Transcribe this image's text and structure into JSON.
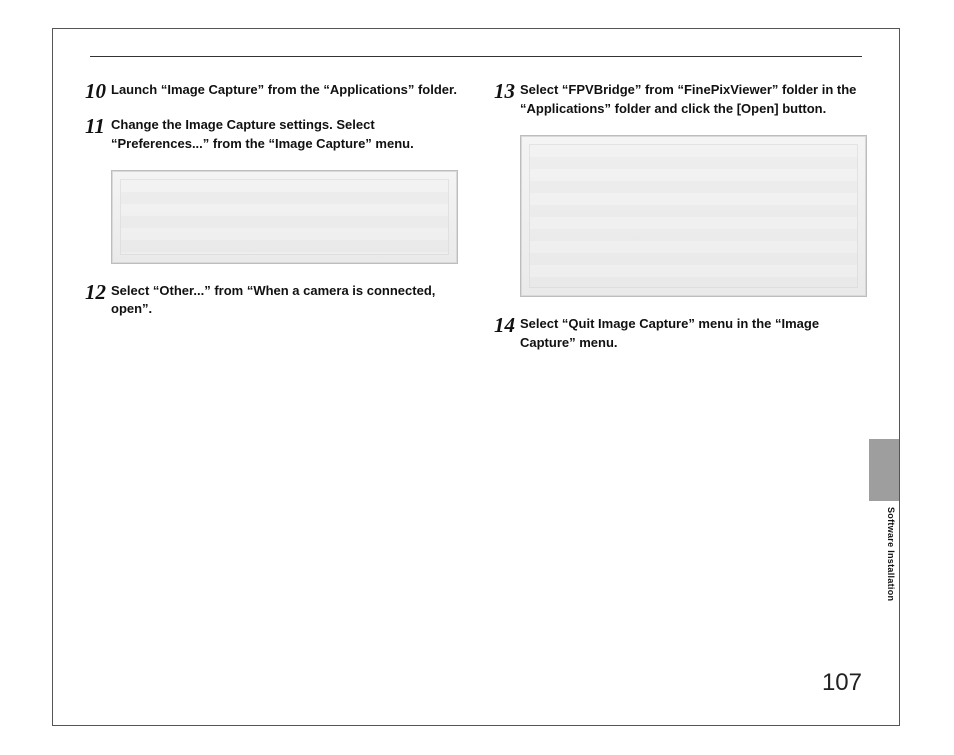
{
  "page_number": "107",
  "side_label": "Software Installation",
  "left": {
    "steps": [
      {
        "num": "10",
        "text": "Launch “Image Capture” from the “Applications” folder."
      },
      {
        "num": "11",
        "text": "Change the Image Capture settings. Select “Preferences...” from the “Image Capture” menu."
      },
      {
        "num": "12",
        "text": "Select “Other...” from “When a camera is connected, open”."
      }
    ]
  },
  "right": {
    "steps": [
      {
        "num": "13",
        "text": "Select “FPVBridge” from “FinePixViewer” folder in the “Applications” folder and click the [Open] button."
      },
      {
        "num": "14",
        "text": "Select “Quit Image Capture” menu in the “Image Capture” menu."
      }
    ]
  }
}
